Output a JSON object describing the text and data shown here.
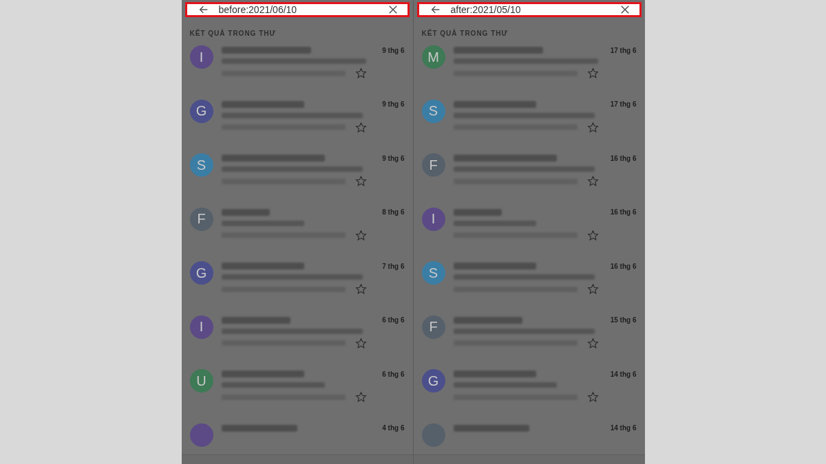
{
  "panels": [
    {
      "query": "before:2021/06/10",
      "section_label": "KẾT QUẢ TRONG THƯ",
      "messages": [
        {
          "letter": "I",
          "color": "#5b4a86",
          "date": "9 thg 6"
        },
        {
          "letter": "G",
          "color": "#4b4f8c",
          "date": "9 thg 6"
        },
        {
          "letter": "S",
          "color": "#3a7ea6",
          "date": "9 thg 6"
        },
        {
          "letter": "F",
          "color": "#56606b",
          "date": "8 thg 6"
        },
        {
          "letter": "G",
          "color": "#4b4f8c",
          "date": "7 thg 6"
        },
        {
          "letter": "I",
          "color": "#5b4a86",
          "date": "6 thg 6"
        },
        {
          "letter": "U",
          "color": "#3d7a55",
          "date": "6 thg 6"
        },
        {
          "color": "#5b4a86",
          "date": "4 thg 6"
        }
      ]
    },
    {
      "query": "after:2021/05/10",
      "section_label": "KẾT QUẢ TRONG THƯ",
      "messages": [
        {
          "letter": "M",
          "color": "#3d7a55",
          "date": "17 thg 6"
        },
        {
          "letter": "S",
          "color": "#3a7ea6",
          "date": "17 thg 6"
        },
        {
          "letter": "F",
          "color": "#56606b",
          "date": "16 thg 6"
        },
        {
          "letter": "I",
          "color": "#5b4a86",
          "date": "16 thg 6"
        },
        {
          "letter": "S",
          "color": "#3a7ea6",
          "date": "16 thg 6"
        },
        {
          "letter": "F",
          "color": "#56606b",
          "date": "15 thg 6"
        },
        {
          "letter": "G",
          "color": "#4b4f8c",
          "date": "14 thg 6"
        },
        {
          "color": "#56606b",
          "date": "14 thg 6"
        }
      ]
    }
  ]
}
